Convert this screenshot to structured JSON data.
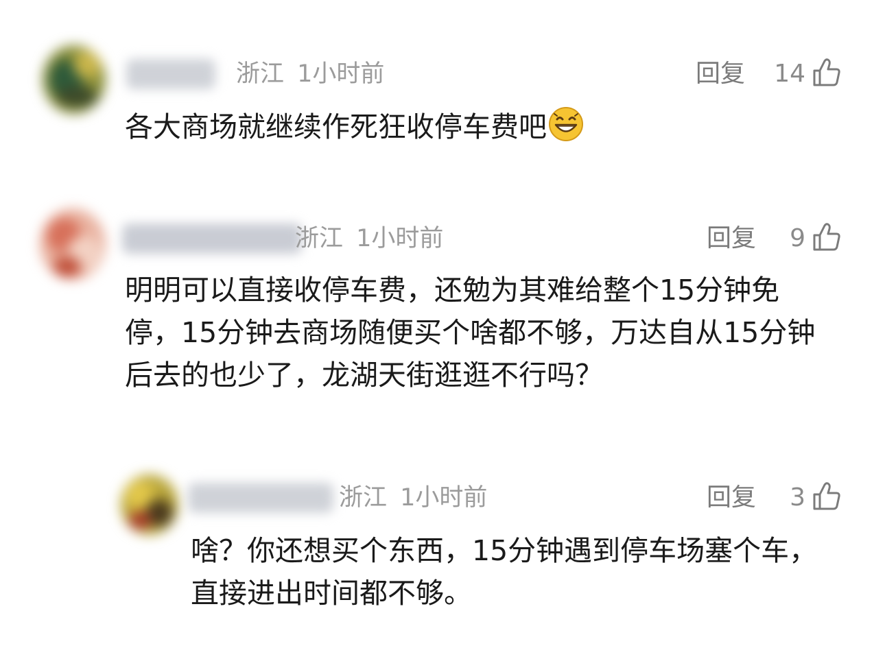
{
  "comments": [
    {
      "username": "",
      "location": "浙江",
      "time": "1小时前",
      "reply_label": "回复",
      "likes": "14",
      "text": "各大商场就继续作死狂收停车费吧",
      "emoji": "grinning-face-emoji"
    },
    {
      "username": "",
      "location": "浙江",
      "time": "1小时前",
      "reply_label": "回复",
      "likes": "9",
      "text": "明明可以直接收停车费，还勉为其难给整个15分钟免停，15分钟去商场随便买个啥都不够，万达自从15分钟后去的也少了，龙湖天街逛逛不行吗？"
    },
    {
      "username": "",
      "location": "浙江",
      "time": "1小时前",
      "reply_label": "回复",
      "likes": "3",
      "text": "啥？你还想买个东西，15分钟遇到停车场塞个车，直接进出时间都不够。"
    }
  ],
  "colors": {
    "meta": "#9b9b9b",
    "text": "#1a1a1a",
    "reply": "#7b7b7b"
  },
  "icons": [
    "thumbs-up-icon",
    "grinning-face-emoji"
  ]
}
